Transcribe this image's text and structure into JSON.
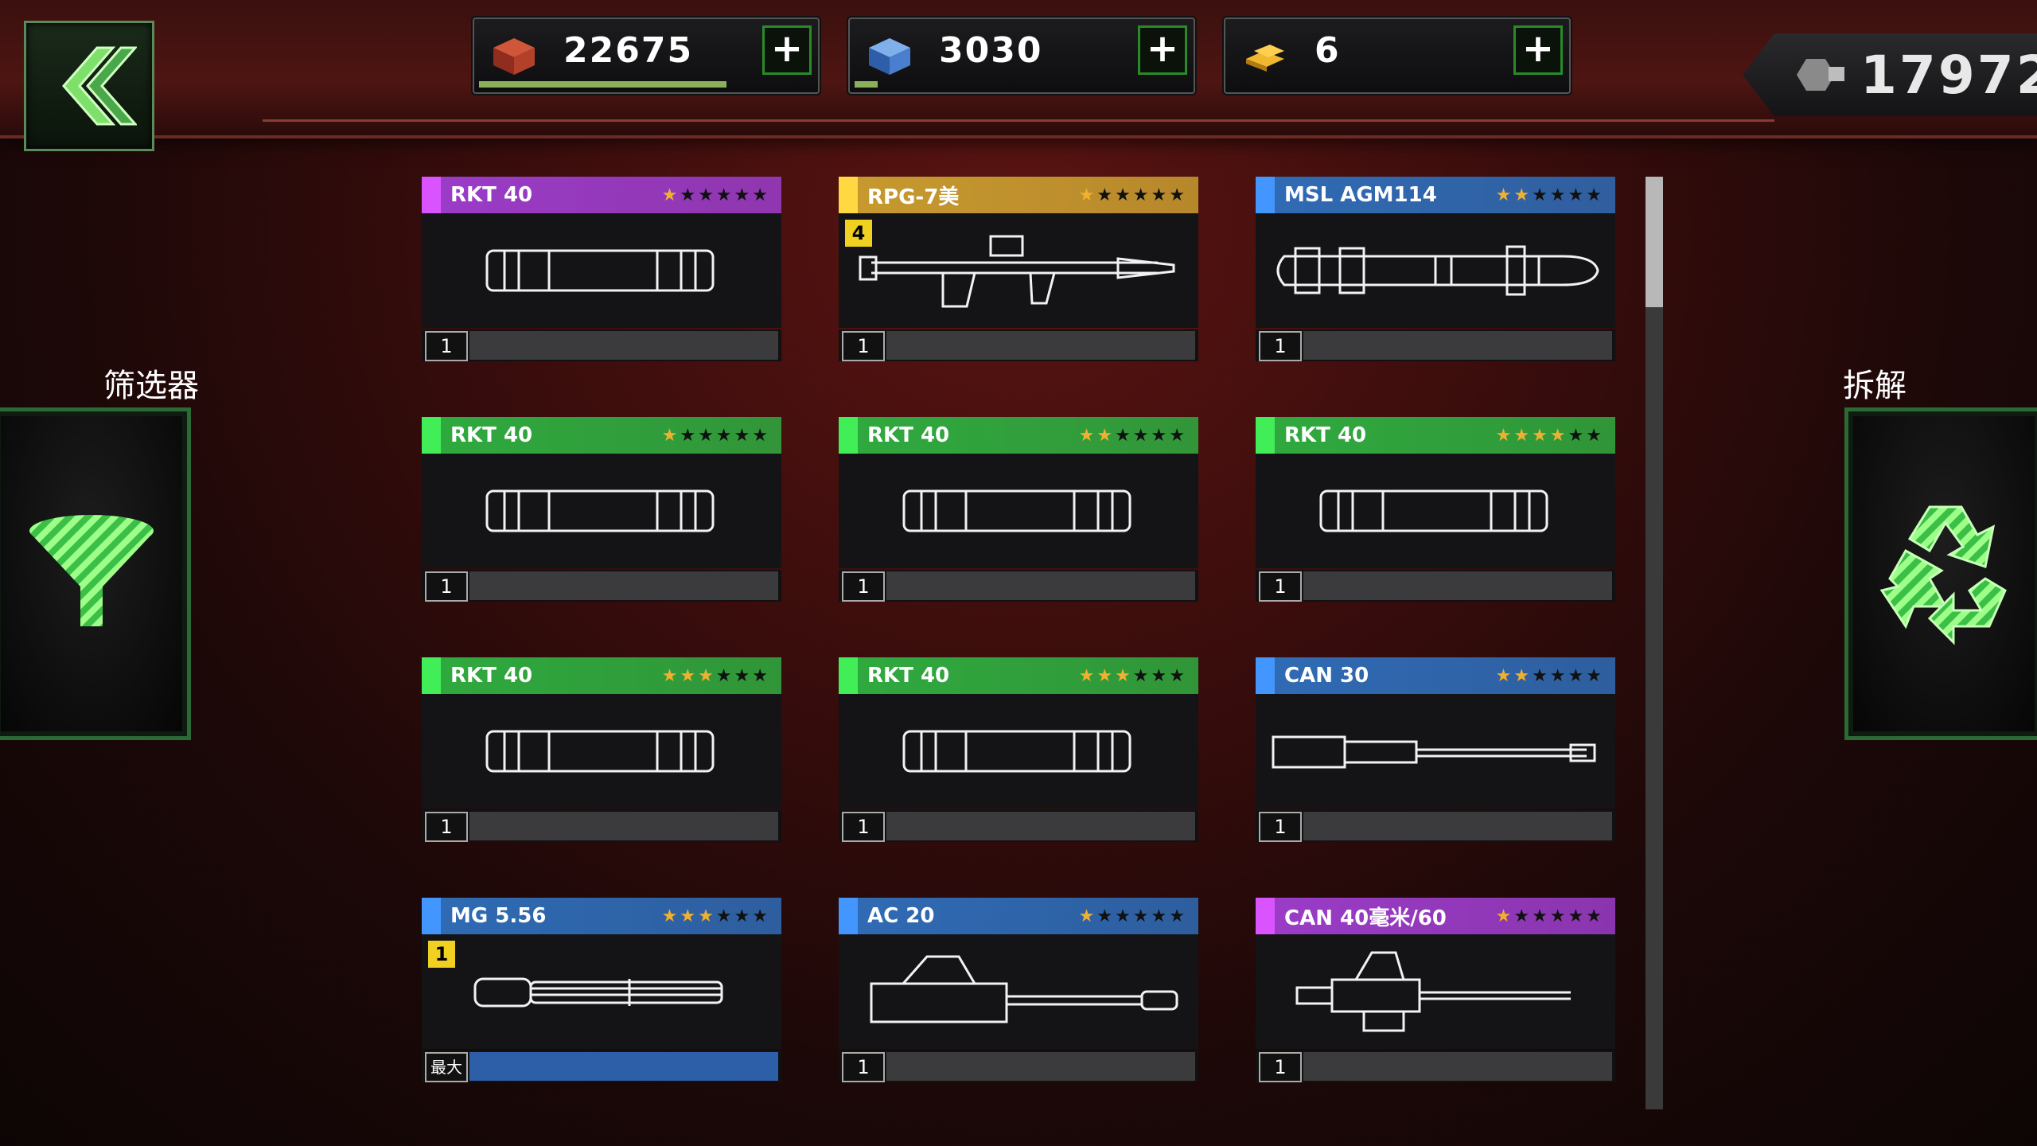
{
  "currencies": [
    {
      "name": "metal-crate",
      "value": "22675",
      "progress": 0.74
    },
    {
      "name": "blue-cube",
      "value": "3030",
      "progress": 0.07
    },
    {
      "name": "gold-bars",
      "value": "6",
      "progress": 0
    }
  ],
  "parts_total": "17972",
  "filter_label": "筛选器",
  "dismantle_label": "拆解",
  "colors": {
    "green": "#2faa3f",
    "purple": "#9b3cc8",
    "blue": "#2f6bb5",
    "gold": "#c79a2f",
    "star": "#f0b030"
  },
  "cards": [
    {
      "name": "RKT 40",
      "rarity": "purple",
      "stars": 1,
      "level": "1",
      "weapon": "rocket"
    },
    {
      "name": "RPG-7美",
      "rarity": "gold",
      "stars": 1,
      "level": "1",
      "weapon": "rpg",
      "badge": "4"
    },
    {
      "name": "MSL AGM114",
      "rarity": "blue",
      "stars": 2,
      "level": "1",
      "weapon": "missile"
    },
    {
      "name": "RKT 40",
      "rarity": "green",
      "stars": 1,
      "level": "1",
      "weapon": "rocket"
    },
    {
      "name": "RKT 40",
      "rarity": "green",
      "stars": 2,
      "level": "1",
      "weapon": "rocket"
    },
    {
      "name": "RKT 40",
      "rarity": "green",
      "stars": 4,
      "level": "1",
      "weapon": "rocket"
    },
    {
      "name": "RKT 40",
      "rarity": "green",
      "stars": 3,
      "level": "1",
      "weapon": "rocket"
    },
    {
      "name": "RKT 40",
      "rarity": "green",
      "stars": 3,
      "level": "1",
      "weapon": "rocket"
    },
    {
      "name": "CAN 30",
      "rarity": "blue",
      "stars": 2,
      "level": "1",
      "weapon": "cannon"
    },
    {
      "name": "MG 5.56",
      "rarity": "blue",
      "stars": 3,
      "level": "最大",
      "weapon": "minigun",
      "badge": "1",
      "maxed": true
    },
    {
      "name": "AC 20",
      "rarity": "blue",
      "stars": 1,
      "level": "1",
      "weapon": "autocannon"
    },
    {
      "name": "CAN 40毫米/60",
      "rarity": "purple",
      "stars": 1,
      "level": "1",
      "weapon": "aa-gun"
    }
  ]
}
